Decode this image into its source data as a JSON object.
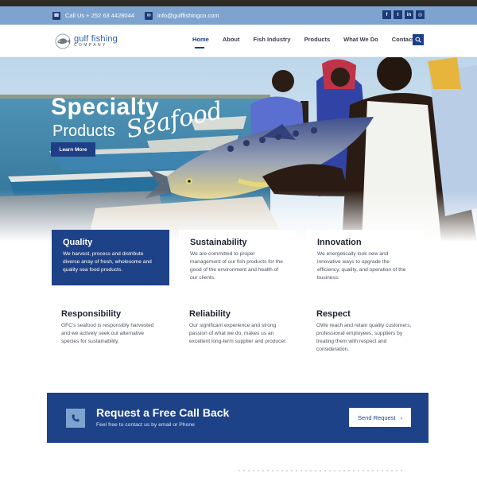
{
  "topbar": {
    "phone_icon": "phone-icon",
    "phone": "Call Us + 252 63 4428044",
    "email_icon": "envelope-icon",
    "email": "info@gulffishingco.com",
    "social": [
      {
        "icon": "facebook-icon",
        "glyph": "f"
      },
      {
        "icon": "twitter-icon",
        "glyph": "t"
      },
      {
        "icon": "linkedin-icon",
        "glyph": "in"
      },
      {
        "icon": "instagram-icon",
        "glyph": "◎"
      }
    ]
  },
  "brand": {
    "line1": "gulf fishing",
    "line2": "COMPANY"
  },
  "nav": {
    "items": [
      "Home",
      "About",
      "Fish Industry",
      "Products",
      "What We Do",
      "Contact"
    ],
    "active": "Home"
  },
  "hero": {
    "title_line1": "Specialty",
    "title_line2": "Products",
    "script": "Seafood",
    "button": "Learn More"
  },
  "features": [
    {
      "title": "Quality",
      "text": "We harvest, process and distribute diverse array of fresh, wholesome and quality sea food products."
    },
    {
      "title": "Sustainability",
      "text": "We are committed to proper management of our fish products for the good of the environment and health of our clients."
    },
    {
      "title": "Innovation",
      "text": "We energetically look new and innovative ways to upgrade the efficiency, quality, and operation of the business."
    },
    {
      "title": "Responsibility",
      "text": "GFC's seafood is responsibly harvested and we actively seek out alternative species for sustainability."
    },
    {
      "title": "Reliability",
      "text": "Our significant experience and strong passion of what we do, makes us an excellent long-term supplier and producer."
    },
    {
      "title": "Respect",
      "text": "OWe reach and retain quality customers, professional employees, suppliers by treating them with respect and consideration."
    }
  ],
  "cta": {
    "title": "Request a Free Call Back",
    "subtitle": "Feel free to contact us by email or Phone",
    "button": "Send Request",
    "button_arrow": "›"
  },
  "colors": {
    "primary": "#1e4287",
    "topbar": "#7ea3cf",
    "nav_text": "#3a3f48"
  }
}
